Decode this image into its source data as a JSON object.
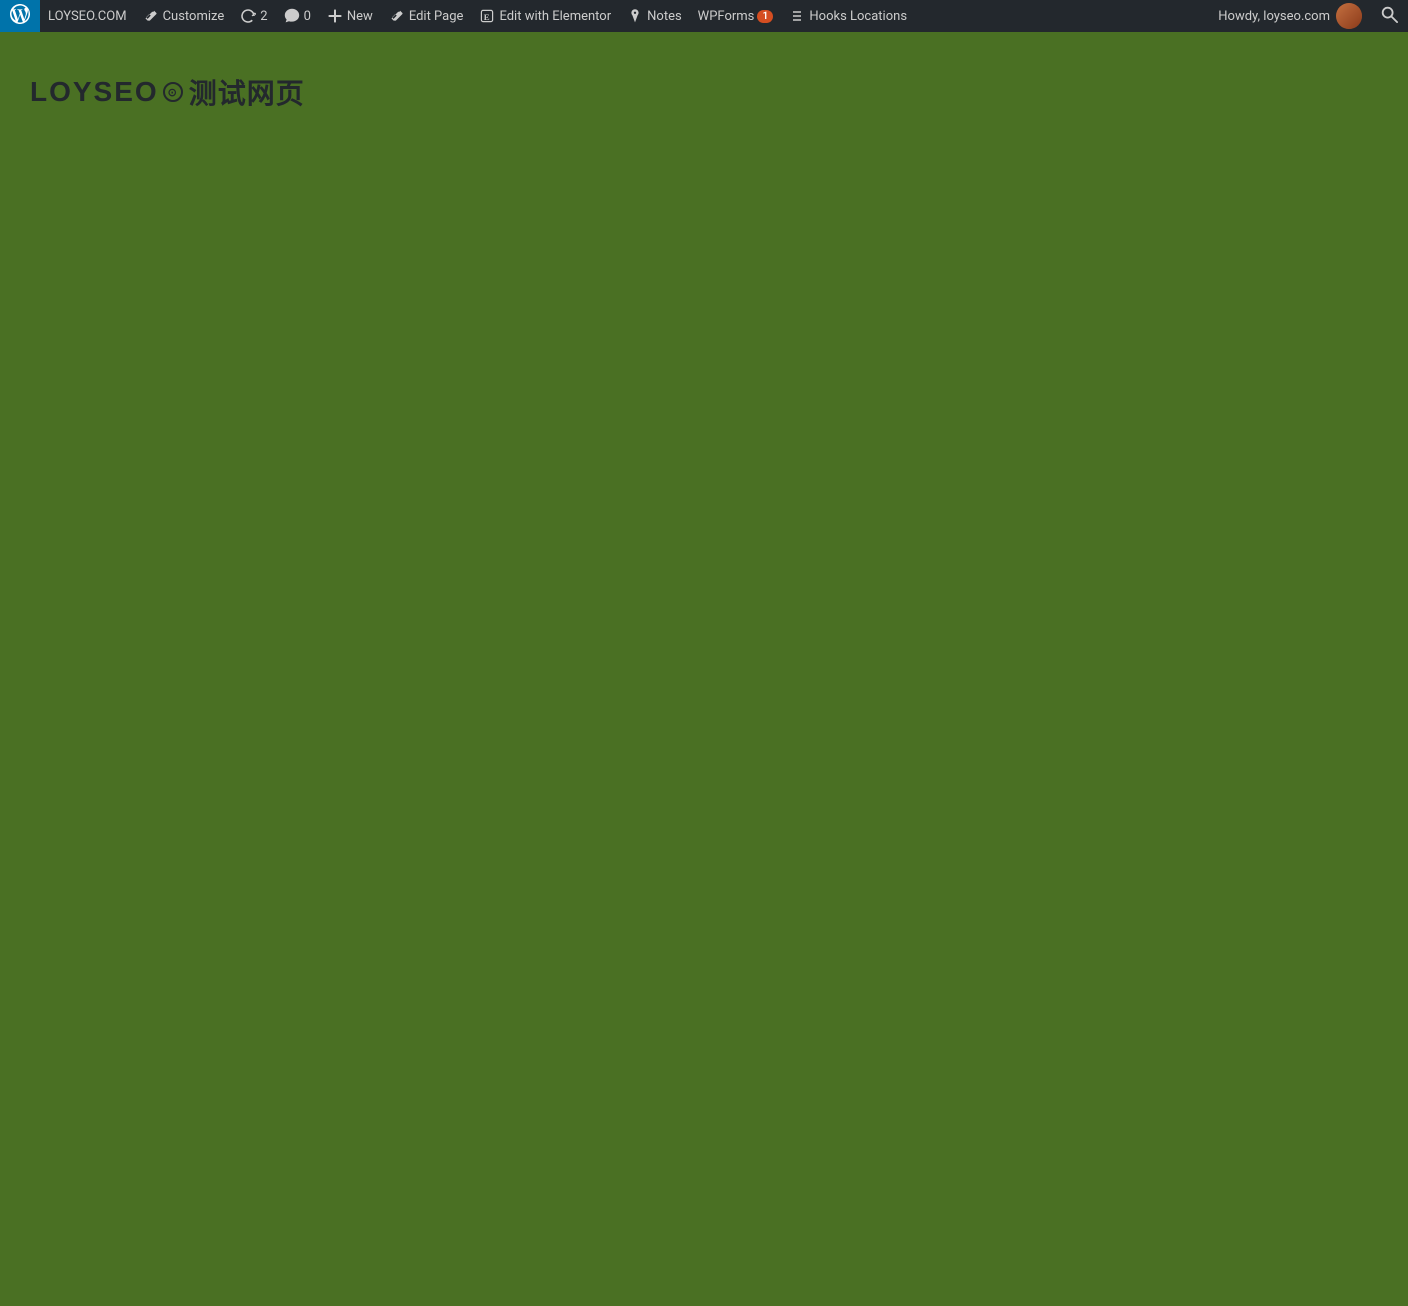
{
  "adminbar": {
    "wp_logo_label": "WordPress",
    "site_name": "LOYSEO.COM",
    "customize_label": "Customize",
    "updates_count": "2",
    "comments_count": "0",
    "new_label": "New",
    "edit_page_label": "Edit Page",
    "elementor_label": "Edit with Elementor",
    "notes_label": "Notes",
    "wpforms_label": "WPForms",
    "wpforms_count": "1",
    "hooks_label": "Hooks Locations",
    "howdy_text": "Howdy, loyseo.com",
    "search_label": "Search"
  },
  "page": {
    "title_latin": "LOYSEO",
    "title_icon": "⊙",
    "title_chinese": "测试网页",
    "background_color": "#4a7023"
  }
}
